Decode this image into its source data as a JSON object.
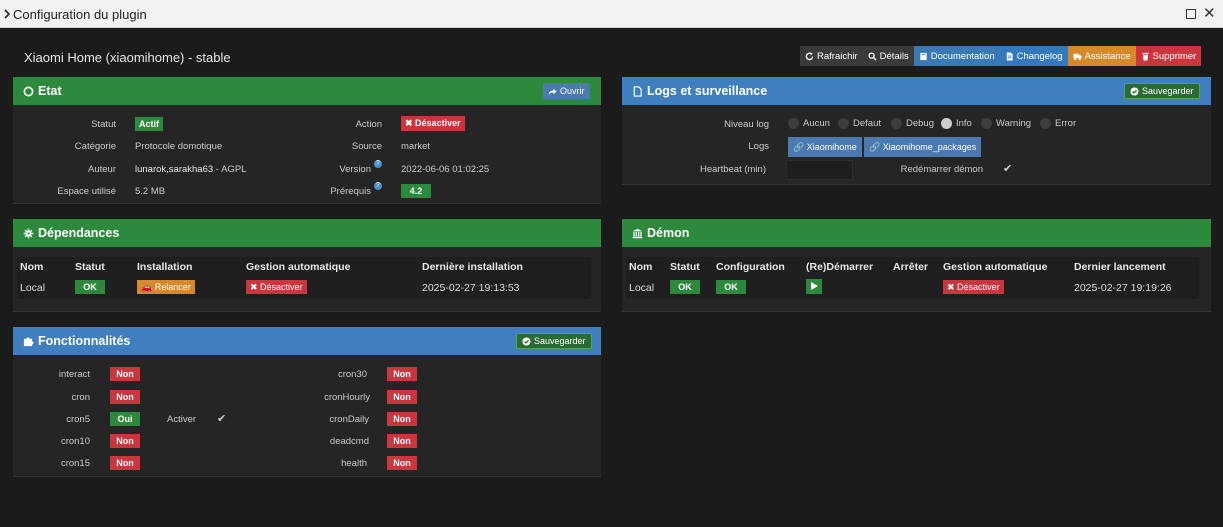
{
  "window": {
    "title": "Configuration du plugin"
  },
  "plugin": {
    "title": "Xiaomi Home (xiaomihome) - stable"
  },
  "toolbar": {
    "refresh": "Rafraichir",
    "details": "Détails",
    "documentation": "Documentation",
    "changelog": "Changelog",
    "assistance": "Assistance",
    "delete": "Supprimer"
  },
  "etat": {
    "title": "Etat",
    "open_label": "Ouvrir",
    "statut_label": "Statut",
    "statut_value": "Actif",
    "categorie_label": "Catégorie",
    "categorie_value": "Protocole domotique",
    "auteur_label": "Auteur",
    "auteur_value": "lunarok,sarakha63",
    "auteur_license": " - AGPL",
    "espace_label": "Espace utilisé",
    "espace_value": "5.2 MB",
    "action_label": "Action",
    "action_value": "Désactiver",
    "source_label": "Source",
    "source_value": "market",
    "version_label": "Version",
    "version_value": "2022-06-06 01:02:25",
    "prerequis_label": "Prérequis",
    "prerequis_value": "4.2",
    "help_glyph": "?"
  },
  "logs": {
    "title": "Logs et surveillance",
    "save_label": "Sauvegarder",
    "niveau_label": "Niveau log",
    "levels": [
      "Aucun",
      "Defaut",
      "Debug",
      "Info",
      "Warning",
      "Error"
    ],
    "selected_level": "Info",
    "logs_label": "Logs",
    "log_buttons": [
      "Xiaomihome",
      "Xiaomihome_packages"
    ],
    "heartbeat_label": "Heartbeat (min)",
    "heartbeat_value": "",
    "restart_label": "Redémarrer démon",
    "restart_checked": true
  },
  "dependances": {
    "title": "Dépendances",
    "headers": [
      "Nom",
      "Statut",
      "Installation",
      "Gestion automatique",
      "Dernière installation"
    ],
    "row": {
      "nom": "Local",
      "statut": "OK",
      "installation": "Relancer",
      "gestion": "Désactiver",
      "derniere": "2025-02-27 19:13:53"
    }
  },
  "demon": {
    "title": "Démon",
    "headers": [
      "Nom",
      "Statut",
      "Configuration",
      "(Re)Démarrer",
      "Arrêter",
      "Gestion automatique",
      "Dernier lancement"
    ],
    "row": {
      "nom": "Local",
      "statut": "OK",
      "configuration": "OK",
      "gestion": "Désactiver",
      "dernier": "2025-02-27 19:19:26"
    }
  },
  "fonctionnalites": {
    "title": "Fonctionnalités",
    "save_label": "Sauvegarder",
    "left": [
      {
        "name": "interact",
        "value": "Non"
      },
      {
        "name": "cron",
        "value": "Non"
      },
      {
        "name": "cron5",
        "value": "Oui"
      },
      {
        "name": "cron10",
        "value": "Non"
      },
      {
        "name": "cron15",
        "value": "Non"
      }
    ],
    "right": [
      {
        "name": "cron30",
        "value": "Non"
      },
      {
        "name": "cronHourly",
        "value": "Non"
      },
      {
        "name": "cronDaily",
        "value": "Non"
      },
      {
        "name": "deadcmd",
        "value": "Non"
      },
      {
        "name": "health",
        "value": "Non"
      }
    ],
    "activer_label": "Activer",
    "activer_checked": true
  },
  "colors": {
    "green": "#2d8a3c",
    "blue_header": "#3f7fbf",
    "red": "#c9363d",
    "orange": "#d6892a"
  }
}
